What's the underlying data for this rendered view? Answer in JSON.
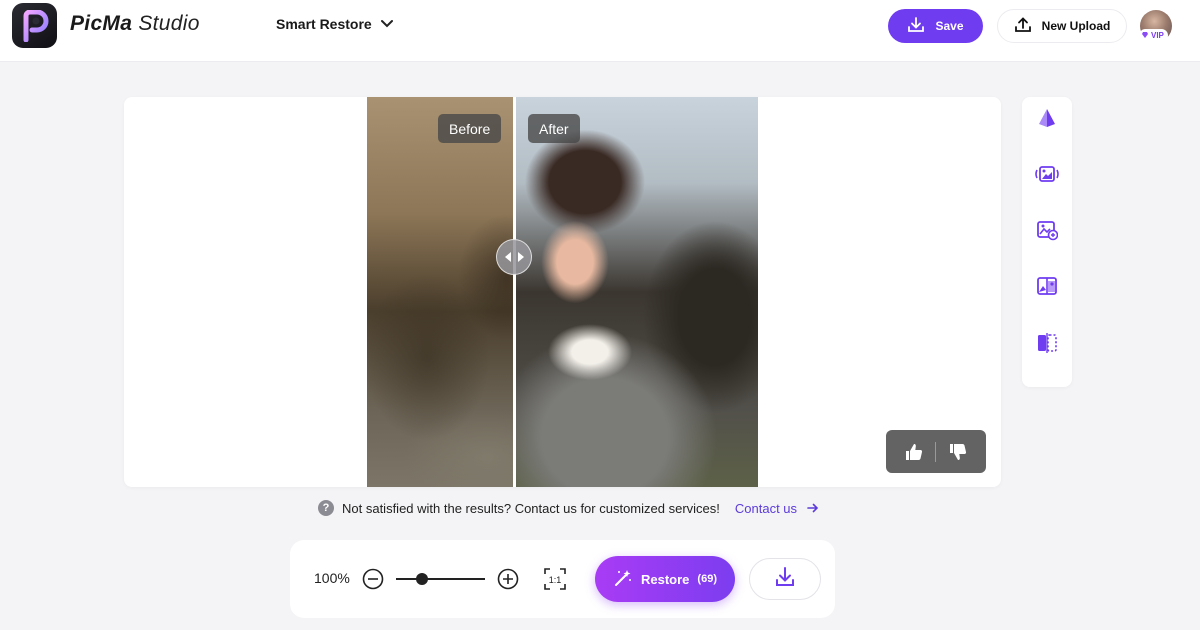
{
  "header": {
    "brand": "PicMa",
    "brand_sub": "Studio",
    "mode": "Smart Restore",
    "save_label": "Save",
    "upload_label": "New Upload",
    "vip_label": "VIP"
  },
  "compare": {
    "before_label": "Before",
    "after_label": "After"
  },
  "notice": {
    "icon": "?",
    "text": "Not satisfied with the results? Contact us for customized services!",
    "link_label": "Contact us"
  },
  "bottombar": {
    "zoom": "100%",
    "fit_label": "1:1",
    "restore_label": "Restore",
    "restore_count": "(69)"
  },
  "colors": {
    "accent": "#6f3cf0",
    "restore_gradient_start": "#a93cf5",
    "restore_gradient_end": "#7c3df0",
    "link": "#5b3bd9",
    "background": "#f4f4f6"
  },
  "icons": {
    "logo": "picma-logo-icon",
    "mode_dropdown": "chevron-down-icon",
    "save": "download-icon",
    "upload": "upload-icon",
    "side_tools": [
      "prism-icon",
      "image-enhance-icon",
      "image-swap-icon",
      "colorize-icon",
      "compare-split-icon"
    ],
    "feedback": [
      "thumbs-up-icon",
      "thumbs-down-icon"
    ]
  }
}
